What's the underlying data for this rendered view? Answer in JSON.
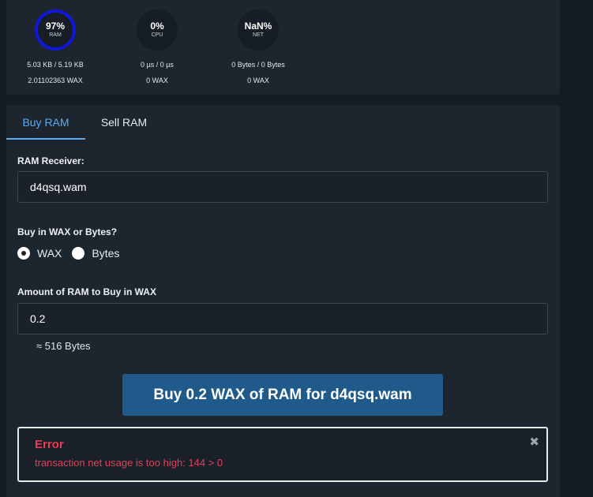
{
  "resources": {
    "ram": {
      "percent": "97%",
      "label": "RAM",
      "usage": "5.03 KB / 5.19 KB",
      "staked": "2.01102363 WAX"
    },
    "cpu": {
      "percent": "0%",
      "label": "CPU",
      "usage": "0 µs / 0 µs",
      "staked": "0 WAX"
    },
    "net": {
      "percent": "NaN%",
      "label": "NET",
      "usage": "0 Bytes / 0 Bytes",
      "staked": "0 WAX"
    }
  },
  "tabs": [
    {
      "label": "Buy RAM",
      "active": true
    },
    {
      "label": "Sell RAM",
      "active": false
    }
  ],
  "form": {
    "receiver_label": "RAM Receiver:",
    "receiver_value": "d4qsq.wam",
    "unit_question": "Buy in WAX or Bytes?",
    "unit_options": [
      {
        "label": "WAX",
        "checked": true
      },
      {
        "label": "Bytes",
        "checked": false
      }
    ],
    "amount_label": "Amount of RAM to Buy in WAX",
    "amount_value": "0.2",
    "approx_bytes": "≈ 516 Bytes",
    "submit_label": "Buy 0.2 WAX of RAM for d4qsq.wam"
  },
  "error": {
    "title": "Error",
    "message": "transaction net usage is too high: 144 > 0",
    "close_glyph": "✖"
  },
  "colors": {
    "ram_ring": "#1116d8",
    "active_tab": "#5da9f0",
    "button_bg": "#1f5a8a",
    "error_text": "#ea3c57"
  }
}
